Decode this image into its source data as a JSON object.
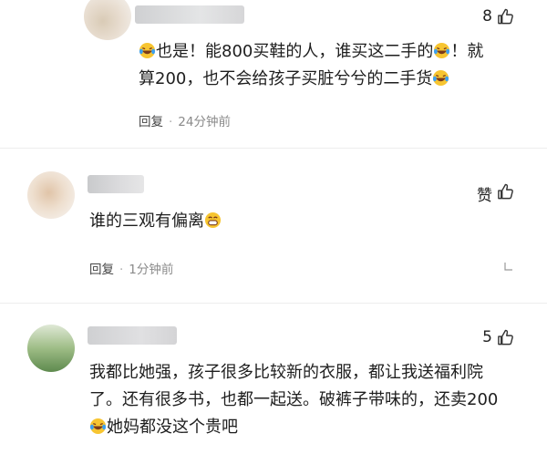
{
  "comments": [
    {
      "likes": "8",
      "lines": [
        [
          "laugh-cry",
          "也是！能800买鞋的人，谁买这二手的",
          "laugh-cry",
          "！就"
        ],
        [
          "",
          "算200，也不会给孩子买脏兮兮的二手货",
          "laugh-cry",
          ""
        ]
      ],
      "reply_label": "回复",
      "time": "24分钟前"
    },
    {
      "like_word": "赞",
      "lines": [
        [
          "",
          "谁的三观有偏离",
          "grin",
          ""
        ]
      ],
      "reply_label": "回复",
      "time": "1分钟前"
    },
    {
      "likes": "5",
      "lines": [
        [
          "",
          "我都比她强，孩子很多比较新的衣服，都让我送福利院",
          "",
          ""
        ],
        [
          "",
          "了。还有很多书，也都一起送。破裤子带味的，还卖200",
          "",
          ""
        ],
        [
          "laugh-cry",
          "她妈都没这个贵吧",
          "",
          ""
        ]
      ]
    }
  ],
  "colors": {
    "text": "#1e1e1e",
    "meta": "#8a8a8a",
    "emoji_yellow": "#f7c531",
    "emoji_tears": "#3b9ff0"
  }
}
